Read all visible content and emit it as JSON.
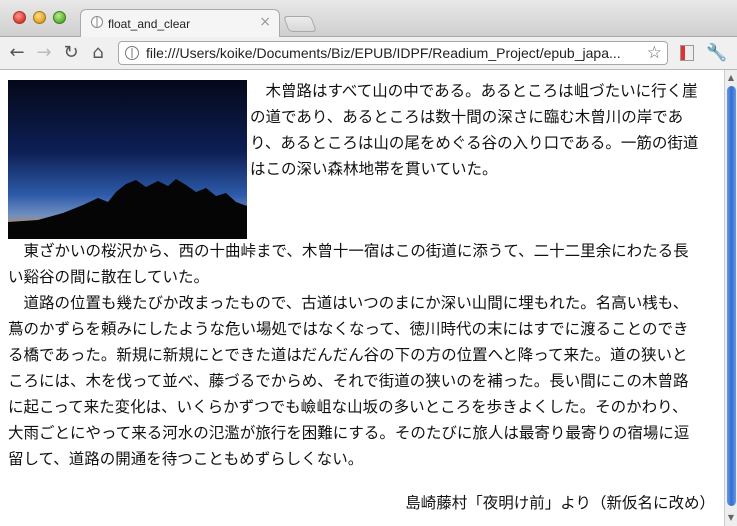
{
  "browser": {
    "tab_title": "float_and_clear",
    "tab_close": "×",
    "url": "file:///Users/koike/Documents/Biz/EPUB/IDPF/Readium_Project/epub_japa...",
    "nav": {
      "back": "←",
      "forward": "→",
      "reload": "↻",
      "home": "⌂"
    },
    "star_icon": "☆",
    "wrench_icon": "🔧"
  },
  "article": {
    "image": {
      "subject": "mountain-silhouette-at-dusk"
    },
    "p1_lines": [
      "　木曾路はすべて山の中である。あるところは岨づたいに行く崖",
      "の道であり、あるところは数十間の深さに臨む木曾川の岸であ",
      "り、あるところは山の尾をめぐる谷の入り口である。一筋の街道",
      "はこの深い森林地帯を貫いていた。"
    ],
    "p2_lines": [
      "　東ざかいの桜沢から、西の十曲峠まで、木曾十一宿はこの街道に添うて、二十二里余にわたる長",
      "い谿谷の間に散在していた。",
      "　道路の位置も幾たびか改まったもので、古道はいつのまにか深い山間に埋もれた。名高い桟も、",
      "蔦のかずらを頼みにしたような危い場処ではなくなって、徳川時代の末にはすでに渡ることのでき",
      "る橋であった。新規に新規にとできた道はだんだん谷の下の方の位置へと降って来た。道の狭いと",
      "ころには、木を伐って並べ、藤づるでからめ、それで街道の狭いのを補った。長い間にこの木曾路",
      "に起こって来た変化は、いくらかずつでも嶮岨な山坂の多いところを歩きよくした。そのかわり、",
      "大雨ごとにやって来る河水の氾濫が旅行を困難にする。そのたびに旅人は最寄り最寄りの宿場に逗",
      "留して、道路の開通を待つこともめずらしくない。"
    ],
    "credit": "島崎藤村「夜明け前」より（新仮名に改め）"
  }
}
